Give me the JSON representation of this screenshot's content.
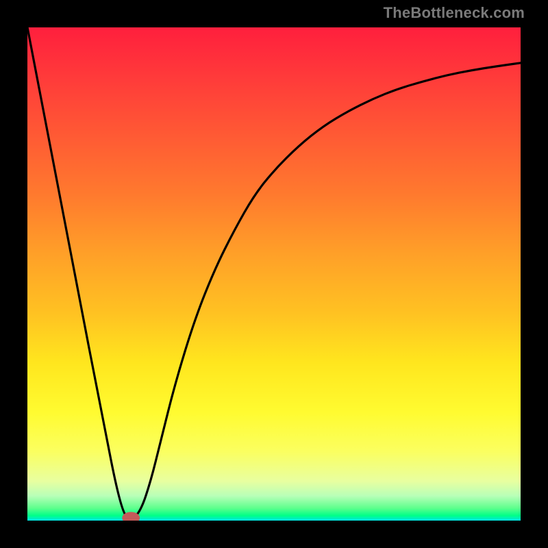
{
  "watermark": "TheBottleneck.com",
  "chart_data": {
    "type": "line",
    "title": "",
    "xlabel": "",
    "ylabel": "",
    "xlim": [
      0,
      1
    ],
    "ylim": [
      0,
      1
    ],
    "gradient_stops": [
      {
        "pos": 0.0,
        "color": "#ff1f3d"
      },
      {
        "pos": 0.1,
        "color": "#ff3a3a"
      },
      {
        "pos": 0.22,
        "color": "#ff5a34"
      },
      {
        "pos": 0.34,
        "color": "#ff7a2e"
      },
      {
        "pos": 0.46,
        "color": "#ffa028"
      },
      {
        "pos": 0.58,
        "color": "#ffc222"
      },
      {
        "pos": 0.68,
        "color": "#ffe61e"
      },
      {
        "pos": 0.78,
        "color": "#fffb30"
      },
      {
        "pos": 0.86,
        "color": "#fbff60"
      },
      {
        "pos": 0.92,
        "color": "#e8ffa0"
      },
      {
        "pos": 0.95,
        "color": "#b8ffb8"
      },
      {
        "pos": 0.975,
        "color": "#5cff8c"
      },
      {
        "pos": 0.99,
        "color": "#00ff88"
      },
      {
        "pos": 1.0,
        "color": "#00e6e6"
      }
    ],
    "series": [
      {
        "name": "bottleneck-curve",
        "x": [
          0.0,
          0.05,
          0.1,
          0.15,
          0.19,
          0.21,
          0.23,
          0.25,
          0.27,
          0.3,
          0.34,
          0.38,
          0.42,
          0.46,
          0.5,
          0.55,
          0.6,
          0.65,
          0.7,
          0.75,
          0.8,
          0.85,
          0.9,
          0.95,
          1.0
        ],
        "y": [
          1.0,
          0.74,
          0.48,
          0.22,
          0.02,
          0.0,
          0.02,
          0.08,
          0.16,
          0.28,
          0.41,
          0.51,
          0.59,
          0.66,
          0.71,
          0.76,
          0.8,
          0.83,
          0.855,
          0.875,
          0.89,
          0.903,
          0.913,
          0.921,
          0.928
        ]
      }
    ],
    "marker": {
      "x": 0.21,
      "y": 0.0,
      "rx": 0.018,
      "ry": 0.012,
      "color": "#c45a5a"
    }
  }
}
